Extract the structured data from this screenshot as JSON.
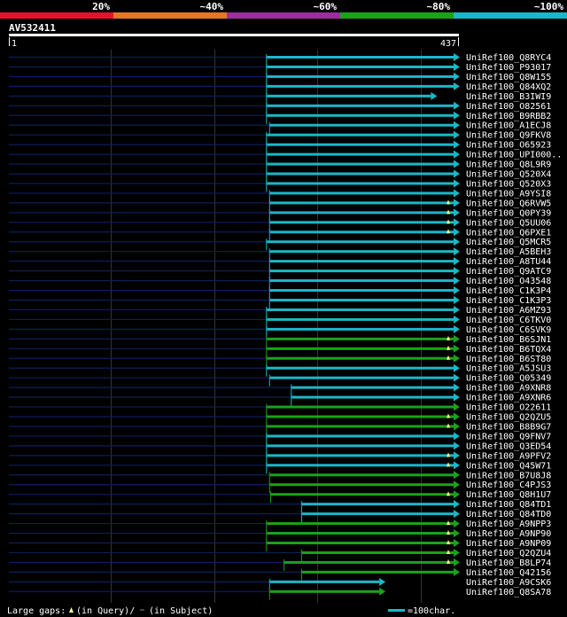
{
  "query_id": "AV532411",
  "identity_bands": [
    {
      "label": "20%",
      "color": "#e8112d"
    },
    {
      "label": "~40%",
      "color": "#e87722"
    },
    {
      "label": "~60%",
      "color": "#9b2f9b"
    },
    {
      "label": "~80%",
      "color": "#1aa31a"
    },
    {
      "label": "~100%",
      "color": "#1ab8c8"
    }
  ],
  "colors": {
    "background": "#000000",
    "subject_track": "#0b1f5c",
    "grid": "#333333",
    "query_bar": "#ffffff",
    "cyan": "#1ab8c8",
    "green": "#1aa31a"
  },
  "footer": {
    "large_gaps_label": "Large gaps:",
    "in_query_label": "(in Query)/",
    "in_subject_label": "(in Subject)",
    "scale_label": "=100char."
  },
  "chart_data": {
    "type": "alignment",
    "title": "AV532411",
    "query_start": 1,
    "query_end": 437,
    "tick_labels": [
      "1",
      "437"
    ],
    "gridlines": [
      100,
      200,
      300,
      400
    ],
    "hits": [
      {
        "name": "UniRef100_Q8RYC4",
        "start": 251,
        "end": 437,
        "identity": "~100%",
        "gap_mark": null
      },
      {
        "name": "UniRef100_P93017",
        "start": 251,
        "end": 437,
        "identity": "~100%",
        "gap_mark": null
      },
      {
        "name": "UniRef100_Q8W155",
        "start": 251,
        "end": 437,
        "identity": "~100%",
        "gap_mark": null
      },
      {
        "name": "UniRef100_Q84XQ2",
        "start": 251,
        "end": 437,
        "identity": "~100%",
        "gap_mark": null
      },
      {
        "name": "UniRef100_B3IWI9",
        "start": 251,
        "end": 415,
        "identity": "~100%",
        "gap_mark": null
      },
      {
        "name": "UniRef100_O82561",
        "start": 251,
        "end": 437,
        "identity": "~100%",
        "gap_mark": null
      },
      {
        "name": "UniRef100_B9RBB2",
        "start": 251,
        "end": 437,
        "identity": "~100%",
        "gap_mark": null
      },
      {
        "name": "UniRef100_A1ECJ8",
        "start": 254,
        "end": 437,
        "identity": "~100%",
        "gap_mark": null
      },
      {
        "name": "UniRef100_Q9FKV8",
        "start": 251,
        "end": 437,
        "identity": "~100%",
        "gap_mark": null
      },
      {
        "name": "UniRef100_O65923",
        "start": 251,
        "end": 437,
        "identity": "~100%",
        "gap_mark": null
      },
      {
        "name": "UniRef100_UPI000..",
        "start": 251,
        "end": 437,
        "identity": "~100%",
        "gap_mark": null
      },
      {
        "name": "UniRef100_Q8L9R9",
        "start": 251,
        "end": 437,
        "identity": "~100%",
        "gap_mark": null
      },
      {
        "name": "UniRef100_Q520X4",
        "start": 251,
        "end": 437,
        "identity": "~100%",
        "gap_mark": null
      },
      {
        "name": "UniRef100_Q520X3",
        "start": 251,
        "end": 437,
        "identity": "~100%",
        "gap_mark": null
      },
      {
        "name": "UniRef100_A9YSI8",
        "start": 254,
        "end": 437,
        "identity": "~100%",
        "gap_mark": null
      },
      {
        "name": "UniRef100_Q6RVW5",
        "start": 254,
        "end": 437,
        "identity": "~100%",
        "gap_mark": "query"
      },
      {
        "name": "UniRef100_Q0PY39",
        "start": 254,
        "end": 437,
        "identity": "~100%",
        "gap_mark": "query"
      },
      {
        "name": "UniRef100_Q5UU06",
        "start": 254,
        "end": 437,
        "identity": "~100%",
        "gap_mark": "query"
      },
      {
        "name": "UniRef100_Q6PXE1",
        "start": 254,
        "end": 437,
        "identity": "~100%",
        "gap_mark": "query"
      },
      {
        "name": "UniRef100_Q5MCR5",
        "start": 251,
        "end": 437,
        "identity": "~100%",
        "gap_mark": null
      },
      {
        "name": "UniRef100_A5BEH3",
        "start": 254,
        "end": 437,
        "identity": "~100%",
        "gap_mark": null
      },
      {
        "name": "UniRef100_A8TU44",
        "start": 254,
        "end": 437,
        "identity": "~100%",
        "gap_mark": null
      },
      {
        "name": "UniRef100_Q9ATC9",
        "start": 254,
        "end": 437,
        "identity": "~100%",
        "gap_mark": null
      },
      {
        "name": "UniRef100_O43548",
        "start": 254,
        "end": 437,
        "identity": "~100%",
        "gap_mark": null
      },
      {
        "name": "UniRef100_C1K3P4",
        "start": 254,
        "end": 437,
        "identity": "~100%",
        "gap_mark": null
      },
      {
        "name": "UniRef100_C1K3P3",
        "start": 254,
        "end": 437,
        "identity": "~100%",
        "gap_mark": null
      },
      {
        "name": "UniRef100_A6MZ93",
        "start": 251,
        "end": 437,
        "identity": "~100%",
        "gap_mark": null
      },
      {
        "name": "UniRef100_C6TKV0",
        "start": 251,
        "end": 437,
        "identity": "~100%",
        "gap_mark": null
      },
      {
        "name": "UniRef100_C6SVK9",
        "start": 251,
        "end": 437,
        "identity": "~100%",
        "gap_mark": null
      },
      {
        "name": "UniRef100_B6SJN1",
        "start": 251,
        "end": 437,
        "identity": "~80%",
        "gap_mark": "query"
      },
      {
        "name": "UniRef100_B6TQX4",
        "start": 251,
        "end": 437,
        "identity": "~80%",
        "gap_mark": "query"
      },
      {
        "name": "UniRef100_B6ST80",
        "start": 251,
        "end": 437,
        "identity": "~80%",
        "gap_mark": "query"
      },
      {
        "name": "UniRef100_A5JSU3",
        "start": 251,
        "end": 437,
        "identity": "~100%",
        "gap_mark": null
      },
      {
        "name": "UniRef100_Q05349",
        "start": 254,
        "end": 437,
        "identity": "~100%",
        "gap_mark": null
      },
      {
        "name": "UniRef100_A9XNR8",
        "start": 275,
        "end": 437,
        "identity": "~100%",
        "gap_mark": null
      },
      {
        "name": "UniRef100_A9XNR6",
        "start": 275,
        "end": 437,
        "identity": "~100%",
        "gap_mark": null
      },
      {
        "name": "UniRef100_O22611",
        "start": 251,
        "end": 437,
        "identity": "~80%",
        "gap_mark": null
      },
      {
        "name": "UniRef100_Q2QZU5",
        "start": 251,
        "end": 437,
        "identity": "~80%",
        "gap_mark": "query"
      },
      {
        "name": "UniRef100_B8B9G7",
        "start": 251,
        "end": 437,
        "identity": "~80%",
        "gap_mark": "query"
      },
      {
        "name": "UniRef100_Q9FNV7",
        "start": 251,
        "end": 437,
        "identity": "~100%",
        "gap_mark": null
      },
      {
        "name": "UniRef100_Q3ED54",
        "start": 251,
        "end": 437,
        "identity": "~100%",
        "gap_mark": null
      },
      {
        "name": "UniRef100_A9PFV2",
        "start": 251,
        "end": 437,
        "identity": "~100%",
        "gap_mark": "query"
      },
      {
        "name": "UniRef100_Q45W71",
        "start": 251,
        "end": 437,
        "identity": "~100%",
        "gap_mark": "query"
      },
      {
        "name": "UniRef100_B7U8J8",
        "start": 254,
        "end": 437,
        "identity": "~80%",
        "gap_mark": null
      },
      {
        "name": "UniRef100_C4PJS3",
        "start": 254,
        "end": 437,
        "identity": "~80%",
        "gap_mark": null
      },
      {
        "name": "UniRef100_Q8H1U7",
        "start": 255,
        "end": 437,
        "identity": "~80%",
        "gap_mark": "query"
      },
      {
        "name": "UniRef100_Q84TD1",
        "start": 285,
        "end": 437,
        "identity": "~100%",
        "gap_mark": null
      },
      {
        "name": "UniRef100_Q84TD0",
        "start": 285,
        "end": 437,
        "identity": "~100%",
        "gap_mark": null
      },
      {
        "name": "UniRef100_A9NPP3",
        "start": 251,
        "end": 437,
        "identity": "~80%",
        "gap_mark": "query"
      },
      {
        "name": "UniRef100_A9NP90",
        "start": 251,
        "end": 437,
        "identity": "~80%",
        "gap_mark": "query"
      },
      {
        "name": "UniRef100_A9NP09",
        "start": 251,
        "end": 437,
        "identity": "~80%",
        "gap_mark": "query"
      },
      {
        "name": "UniRef100_Q2QZU4",
        "start": 285,
        "end": 437,
        "identity": "~80%",
        "gap_mark": "query"
      },
      {
        "name": "UniRef100_B8LP74",
        "start": 268,
        "end": 437,
        "identity": "~80%",
        "gap_mark": "query"
      },
      {
        "name": "UniRef100_Q42156",
        "start": 285,
        "end": 437,
        "identity": "~80%",
        "gap_mark": null
      },
      {
        "name": "UniRef100_A9CSK6",
        "start": 254,
        "end": 365,
        "identity": "~100%",
        "gap_mark": null
      },
      {
        "name": "UniRef100_Q8SA78",
        "start": 254,
        "end": 365,
        "identity": "~80%",
        "gap_mark": null
      }
    ]
  }
}
